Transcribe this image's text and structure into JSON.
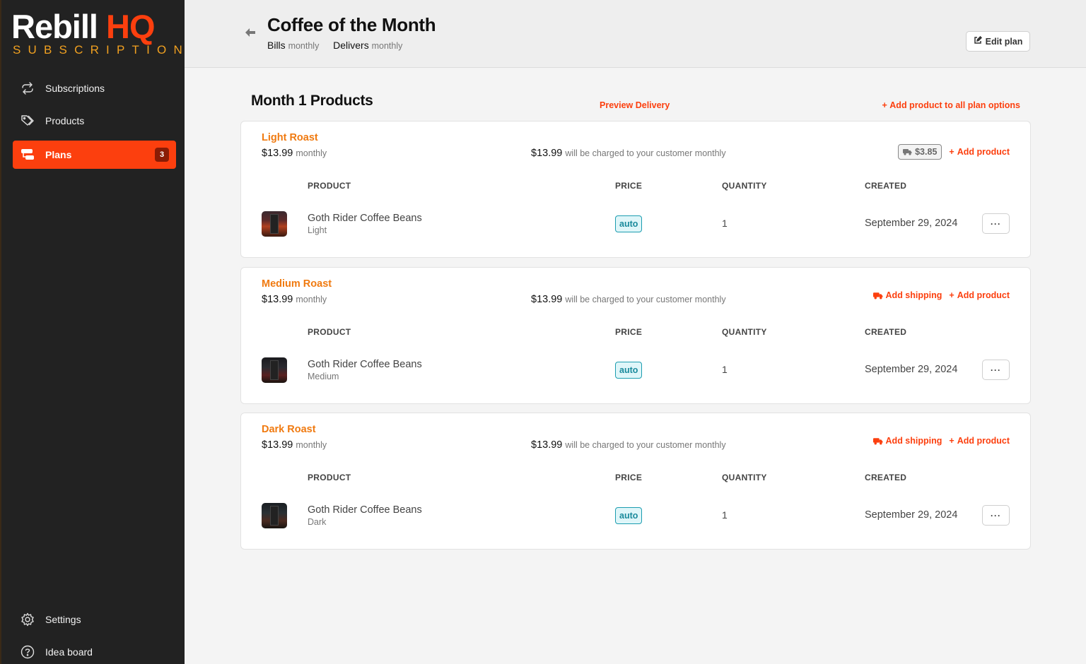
{
  "brand": {
    "name_part1": "Rebill",
    "name_part2": "HQ",
    "tagline": "SUBSCRIPTIONS",
    "accent_color": "#fc3f0e",
    "tagline_color": "#f0a020"
  },
  "sidebar": {
    "items": [
      {
        "label": "Subscriptions",
        "icon": "repeat-icon"
      },
      {
        "label": "Products",
        "icon": "tags-icon"
      },
      {
        "label": "Plans",
        "icon": "plans-icon",
        "badge": "3",
        "active": true
      }
    ],
    "bottom_items": [
      {
        "label": "Settings",
        "icon": "gear-icon"
      },
      {
        "label": "Idea board",
        "icon": "question-circle-icon"
      }
    ]
  },
  "header": {
    "title": "Coffee of the Month",
    "bills_label": "Bills",
    "bills_value": "monthly",
    "delivers_label": "Delivers",
    "delivers_value": "monthly",
    "edit_button": "Edit plan"
  },
  "main": {
    "section_title": "Month 1 Products",
    "preview_link": "Preview Delivery",
    "add_all_link": "Add product to all plan options",
    "columns": [
      "PRODUCT",
      "PRICE",
      "QUANTITY",
      "CREATED"
    ],
    "plans": [
      {
        "name": "Light Roast",
        "price": "$13.99",
        "interval": "monthly",
        "charge_amount": "$13.99",
        "charge_text": "will be charged to your customer monthly",
        "shipping_badge": "$3.85",
        "add_shipping": null,
        "add_product": "Add product",
        "products": [
          {
            "name": "Goth Rider Coffee Beans",
            "variant": "Light",
            "price": "auto",
            "quantity": "1",
            "created": "September 29, 2024",
            "more": "···"
          }
        ]
      },
      {
        "name": "Medium Roast",
        "price": "$13.99",
        "interval": "monthly",
        "charge_amount": "$13.99",
        "charge_text": "will be charged to your customer monthly",
        "shipping_badge": null,
        "add_shipping": "Add shipping",
        "add_product": "Add product",
        "products": [
          {
            "name": "Goth Rider Coffee Beans",
            "variant": "Medium",
            "price": "auto",
            "quantity": "1",
            "created": "September 29, 2024",
            "more": "···"
          }
        ]
      },
      {
        "name": "Dark Roast",
        "price": "$13.99",
        "interval": "monthly",
        "charge_amount": "$13.99",
        "charge_text": "will be charged to your customer monthly",
        "shipping_badge": null,
        "add_shipping": "Add shipping",
        "add_product": "Add product",
        "products": [
          {
            "name": "Goth Rider Coffee Beans",
            "variant": "Dark",
            "price": "auto",
            "quantity": "1",
            "created": "September 29, 2024",
            "more": "···"
          }
        ]
      }
    ]
  }
}
